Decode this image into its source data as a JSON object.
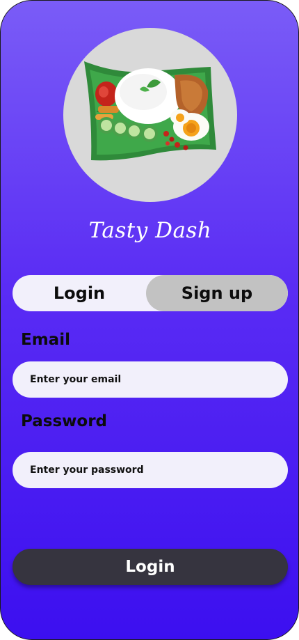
{
  "app": {
    "title": "Tasty Dash",
    "logo_icon": "nasi-lemak-icon"
  },
  "auth_toggle": {
    "login_label": "Login",
    "signup_label": "Sign up",
    "selected": "Sign up"
  },
  "form": {
    "email_label": "Email",
    "email_placeholder": "Enter your email",
    "email_value": "",
    "password_label": "Password",
    "password_placeholder": "Enter your password",
    "password_value": ""
  },
  "submit": {
    "label": "Login"
  },
  "colors": {
    "background_top": "#7a5cf7",
    "background_bottom": "#3c0ff0",
    "input_fill": "#f2f0fb",
    "toggle_selected": "#c2c2c2",
    "button_fill": "#36343f",
    "logo_circle": "#d9d9d9"
  }
}
